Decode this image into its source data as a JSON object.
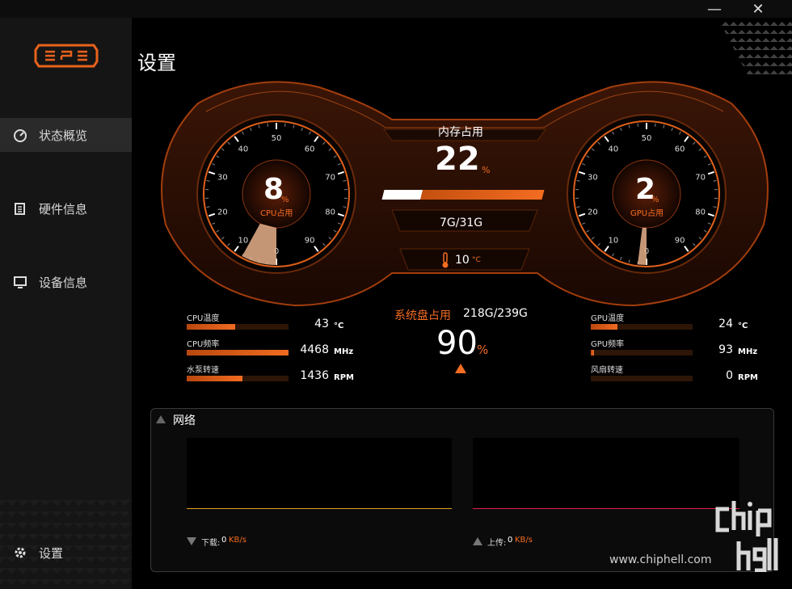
{
  "app": {
    "page_title": "设置"
  },
  "window": {
    "minimize": "—",
    "close": "✕"
  },
  "sidebar": {
    "items": [
      {
        "label": "状态概览",
        "icon": "dashboard-icon",
        "active": true
      },
      {
        "label": "硬件信息",
        "icon": "hardware-icon",
        "active": false
      },
      {
        "label": "设备信息",
        "icon": "monitor-icon",
        "active": false
      }
    ],
    "settings_label": "设置",
    "settings_icon": "gear-icon"
  },
  "cpu_gauge": {
    "value": "8",
    "unit": "%",
    "label": "CPU占用",
    "ticks": [
      "0",
      "10",
      "20",
      "30",
      "40",
      "50",
      "60",
      "70",
      "80",
      "90"
    ],
    "level": 8
  },
  "gpu_gauge": {
    "value": "2",
    "unit": "%",
    "label": "GPU占用",
    "ticks": [
      "0",
      "10",
      "20",
      "30",
      "40",
      "50",
      "60",
      "70",
      "80",
      "90"
    ],
    "level": 2
  },
  "memory": {
    "title": "内存占用",
    "value": "22",
    "unit": "%",
    "usage": "7G/31G",
    "level": 22
  },
  "temperature": {
    "value": "10",
    "unit": "°C",
    "icon": "thermometer-icon"
  },
  "cpu_stats": [
    {
      "label": "CPU温度",
      "value": "43",
      "unit": "°C",
      "level": 0.48
    },
    {
      "label": "CPU频率",
      "value": "4468",
      "unit": "MHz",
      "level": 1.0
    },
    {
      "label": "水泵转速",
      "value": "1436",
      "unit": "RPM",
      "level": 0.55
    }
  ],
  "gpu_stats": [
    {
      "label": "GPU温度",
      "value": "24",
      "unit": "°C",
      "level": 0.26
    },
    {
      "label": "GPU频率",
      "value": "93",
      "unit": "MHz",
      "level": 0.03
    },
    {
      "label": "风扇转速",
      "value": "0",
      "unit": "RPM",
      "level": 0
    }
  ],
  "disk": {
    "title": "系统盘占用",
    "usage": "218G/239G",
    "value": "90",
    "unit": "%"
  },
  "network": {
    "title": "网络",
    "download_label": "下载:",
    "download_value": "0",
    "download_unit": "KB/s",
    "upload_label": "上传:",
    "upload_value": "0",
    "upload_unit": "KB/s"
  },
  "watermark": {
    "url": "www.chiphell.com",
    "logo_text": "chip hell"
  },
  "colors": {
    "accent": "#f36c21",
    "download_line": "#e0a020",
    "upload_line": "#e0204a"
  }
}
